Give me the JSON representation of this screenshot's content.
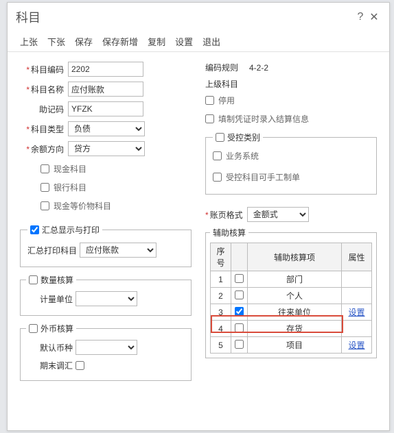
{
  "title": "科目",
  "titlebar": {
    "help": "?",
    "close": "✕"
  },
  "toolbar": [
    "上张",
    "下张",
    "保存",
    "保存新增",
    "复制",
    "设置",
    "退出"
  ],
  "left": {
    "code_label": "科目编码",
    "code_value": "2202",
    "name_label": "科目名称",
    "name_value": "应付账款",
    "memo_label": "助记码",
    "memo_value": "YFZK",
    "type_label": "科目类型",
    "type_value": "负债",
    "balance_label": "余额方向",
    "balance_value": "贷方",
    "chk_cash": "现金科目",
    "chk_bank": "银行科目",
    "chk_cashlike": "现金等价物科目",
    "summary_title": "汇总显示与打印",
    "summary_print_label": "汇总打印科目",
    "summary_print_value": "应付账款",
    "qty_title": "数量核算",
    "qty_unit_label": "计量单位",
    "fx_title": "外币核算",
    "fx_curr_label": "默认币种",
    "fx_adj_label": "期末调汇"
  },
  "right": {
    "rule_label": "编码规则",
    "rule_value": "4-2-2",
    "parent_label": "上级科目",
    "chk_disabled": "停用",
    "chk_voucher": "填制凭证时录入结算信息",
    "ctrl_title": "受控类别",
    "ctrl_biz": "业务系统",
    "ctrl_manual": "受控科目可手工制单",
    "format_label": "账页格式",
    "format_value": "金额式",
    "aux_title": "辅助核算",
    "aux_cols": {
      "no": "序号",
      "chk": "",
      "item": "辅助核算项",
      "attr": "属性"
    },
    "aux_rows": [
      {
        "no": "1",
        "checked": false,
        "item": "部门",
        "attr": ""
      },
      {
        "no": "2",
        "checked": false,
        "item": "个人",
        "attr": ""
      },
      {
        "no": "3",
        "checked": true,
        "item": "往来单位",
        "attr": "设置"
      },
      {
        "no": "4",
        "checked": false,
        "item": "存货",
        "attr": ""
      },
      {
        "no": "5",
        "checked": false,
        "item": "项目",
        "attr": "设置"
      }
    ]
  }
}
